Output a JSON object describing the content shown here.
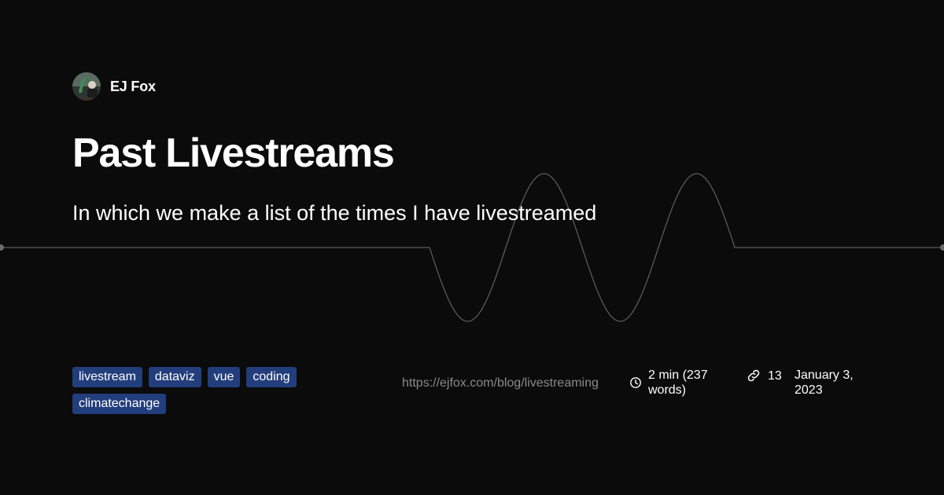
{
  "author": {
    "name": "EJ Fox",
    "avatar_icon": "avatar-photo"
  },
  "post": {
    "title": "Past Livestreams",
    "subtitle": "In which we make a list of the times I have livestreamed",
    "tags": [
      "livestream",
      "dataviz",
      "vue",
      "coding",
      "climatechange"
    ],
    "url": "https://ejfox.com/blog/livestreaming",
    "reading_time": "2 min (237 words)",
    "link_count": "13",
    "date": "January 3, 2023"
  },
  "icons": {
    "time": "clock-icon",
    "links": "link-icon"
  },
  "colors": {
    "background": "#0b0b0b",
    "tag_background": "#233e7c",
    "url_text": "#8a8a8a",
    "wave_line": "#5a5a5a"
  }
}
